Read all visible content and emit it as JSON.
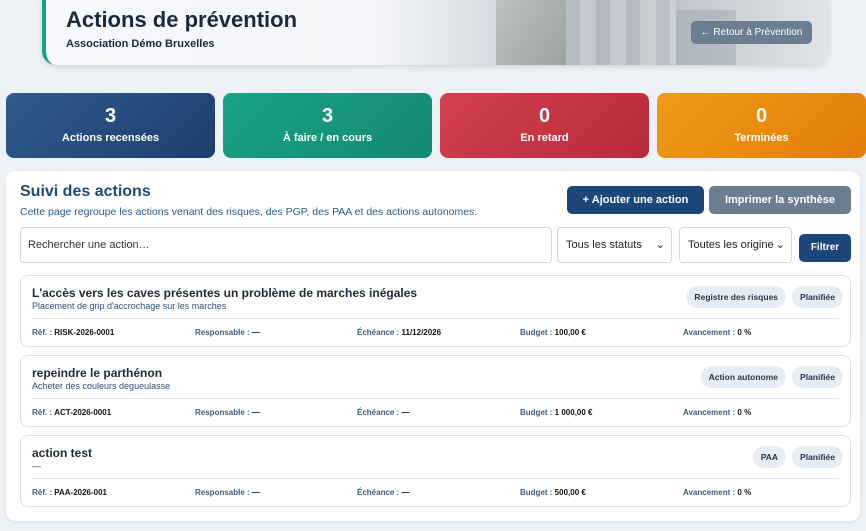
{
  "header": {
    "title": "Actions de prévention",
    "subtitle": "Association Démo Bruxelles",
    "back_label": "← Retour à Prévention"
  },
  "stats": [
    {
      "value": "3",
      "label": "Actions recensées",
      "color": "#24497b"
    },
    {
      "value": "3",
      "label": "À faire / en cours",
      "color": "#16977c"
    },
    {
      "value": "0",
      "label": "En retard",
      "color": "#c83546"
    },
    {
      "value": "0",
      "label": "Terminées",
      "color": "#ea8c10"
    }
  ],
  "panel": {
    "title": "Suivi des actions",
    "description": "Cette page regroupe les actions venant des risques, des PGP, des PAA et des actions autonomes.",
    "add_label": "+ Ajouter une action",
    "print_label": "Imprimer la synthèse",
    "search_placeholder": "Rechercher une action…",
    "status_select": "Tous les statuts",
    "origin_select": "Toutes les origines",
    "filter_label": "Filtrer"
  },
  "labels": {
    "ref": "Réf. :",
    "responsable": "Responsable :",
    "echeance": "Échéance :",
    "budget": "Budget :",
    "avancement": "Avancement :"
  },
  "actions": [
    {
      "title": "L'accès vers les caves présentes un problème de marches inégales",
      "subtitle": "Placement de grip d'accrochage sur les marches",
      "origin": "Registre des risques",
      "status": "Planifiée",
      "ref": "RISK-2026-0001",
      "responsable": "—",
      "echeance": "11/12/2026",
      "budget": "100,00 €",
      "avancement": "0 %"
    },
    {
      "title": "repeindre le parthénon",
      "subtitle": "Acheter des couleurs dégueulasse",
      "origin": "Action autonome",
      "status": "Planifiée",
      "ref": "ACT-2026-0001",
      "responsable": "—",
      "echeance": "—",
      "budget": "1 000,00 €",
      "avancement": "0 %"
    },
    {
      "title": "action test",
      "subtitle": "—",
      "origin": "PAA",
      "status": "Planifiée",
      "ref": "PAA-2026-001",
      "responsable": "—",
      "echeance": "—",
      "budget": "500,00 €",
      "avancement": "0 %"
    }
  ]
}
